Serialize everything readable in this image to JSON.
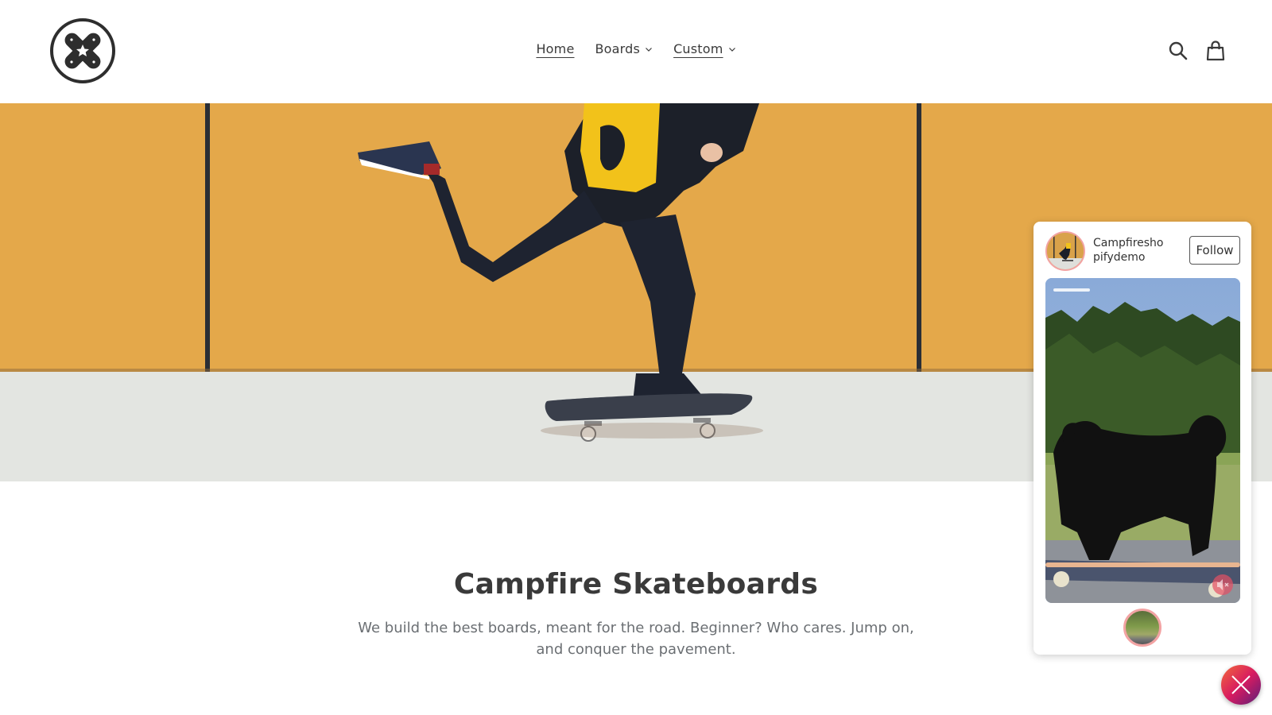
{
  "header": {
    "logo_name": "Campfire Skateboards logo",
    "nav": [
      {
        "label": "Home",
        "underlined": true,
        "has_dropdown": false
      },
      {
        "label": "Boards",
        "underlined": false,
        "has_dropdown": true
      },
      {
        "label": "Custom",
        "underlined": true,
        "has_dropdown": true
      }
    ],
    "icons": {
      "search": "search-icon",
      "cart": "cart-icon"
    }
  },
  "hero": {
    "image_description": "Skateboarder in black jeans and yellow backpack riding a skateboard in front of an orange wall",
    "wall_color": "#e4a84a",
    "ground_color": "#e2e4e0"
  },
  "intro": {
    "title": "Campfire Skateboards",
    "text": "We build the best boards, meant for the road. Beginner? Who cares. Jump on, and conquer the pavement."
  },
  "widget": {
    "account_name": "Campfireshopifydemo",
    "account_name_line1": "Campfiresho",
    "account_name_line2": "pifydemo",
    "follow_label": "Follow",
    "video_description": "Black poodle standing on a longboard on a road with trees behind",
    "muted": true,
    "accent_color": "#f2a3a3"
  },
  "close_button": {
    "icon": "close-icon",
    "gradient": [
      "#f26b3a",
      "#d81b60",
      "#5a1f7a"
    ]
  }
}
